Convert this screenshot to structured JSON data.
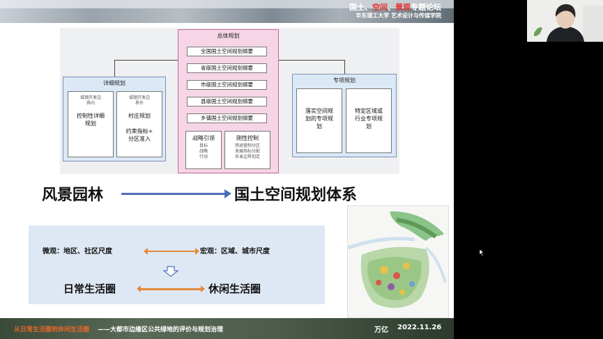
{
  "banner": {
    "title_prefix": "国土、",
    "title_red1": "空间",
    "title_mid": "、",
    "title_red2": "景观",
    "title_suffix": "专题论坛",
    "subtitle": "华东理工大学 艺术设计与传媒学院"
  },
  "diagram": {
    "center_head": "总体规划",
    "center_items": [
      "全国国土空间规划纲要",
      "省级国土空间规划纲要",
      "市级国土空间规划纲要",
      "县级国土空间规划纲要",
      "乡镇国土空间规划纲要"
    ],
    "strategy": {
      "title": "战略引领",
      "lines": [
        "目标",
        "战略",
        "行动"
      ]
    },
    "control": {
      "title": "刚性控制",
      "lines": [
        "用途管制分区",
        "发展指标分配",
        "名录边界划定"
      ]
    },
    "left_head": "详细规划",
    "left_card1": {
      "note": [
        "城镇开发边",
        "界内"
      ],
      "main": [
        "控制性详细",
        "规划"
      ]
    },
    "left_card2": {
      "note": [
        "城镇开发边",
        "界外"
      ],
      "main": [
        "村庄规划",
        "",
        "约束指标+",
        "分区准入"
      ]
    },
    "right_head": "专项规划",
    "right_card1": [
      "落实空间规",
      "划的专项规",
      "划"
    ],
    "right_card2": [
      "特定区域或",
      "行业专项规",
      "划"
    ]
  },
  "headline": {
    "left": "风景园林",
    "right": "国土空间规划体系"
  },
  "scale": {
    "micro": "微观：地区、社区尺度",
    "macro": "宏观：区域、城市尺度",
    "life_left": "日常生活圈",
    "life_right": "休闲生活圈"
  },
  "footer": {
    "left_orange": "从日常生活圈到休闲生活圈",
    "left_white": "——大都市边缘区公共绿地的评价与规划治理",
    "author": "万亿",
    "date": "2022.11.26"
  },
  "colors": {
    "accent_red": "#e5322d",
    "arrow_blue": "#4d6fb8",
    "arrow_orange": "#e38a3b",
    "panel_blue": "#dde8f4",
    "center_pink": "#f6d5e6"
  }
}
